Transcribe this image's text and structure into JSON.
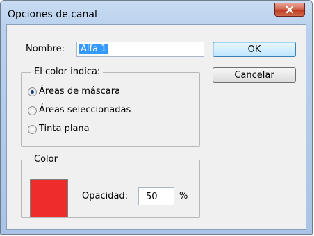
{
  "window": {
    "title": "Opciones de canal",
    "close_glyph": "✕"
  },
  "name_field": {
    "label": "Nombre:",
    "value": "Alfa 1"
  },
  "buttons": {
    "ok": "OK",
    "cancel": "Cancelar"
  },
  "color_indicates": {
    "legend": "El color indica:",
    "options": [
      {
        "label": "Áreas de máscara",
        "selected": true
      },
      {
        "label": "Áreas seleccionadas",
        "selected": false
      },
      {
        "label": "Tinta plana",
        "selected": false
      }
    ]
  },
  "color_group": {
    "legend": "Color",
    "swatch_color": "#ee2c2c",
    "opacity_label": "Opacidad:",
    "opacity_value": "50",
    "opacity_unit": "%"
  }
}
